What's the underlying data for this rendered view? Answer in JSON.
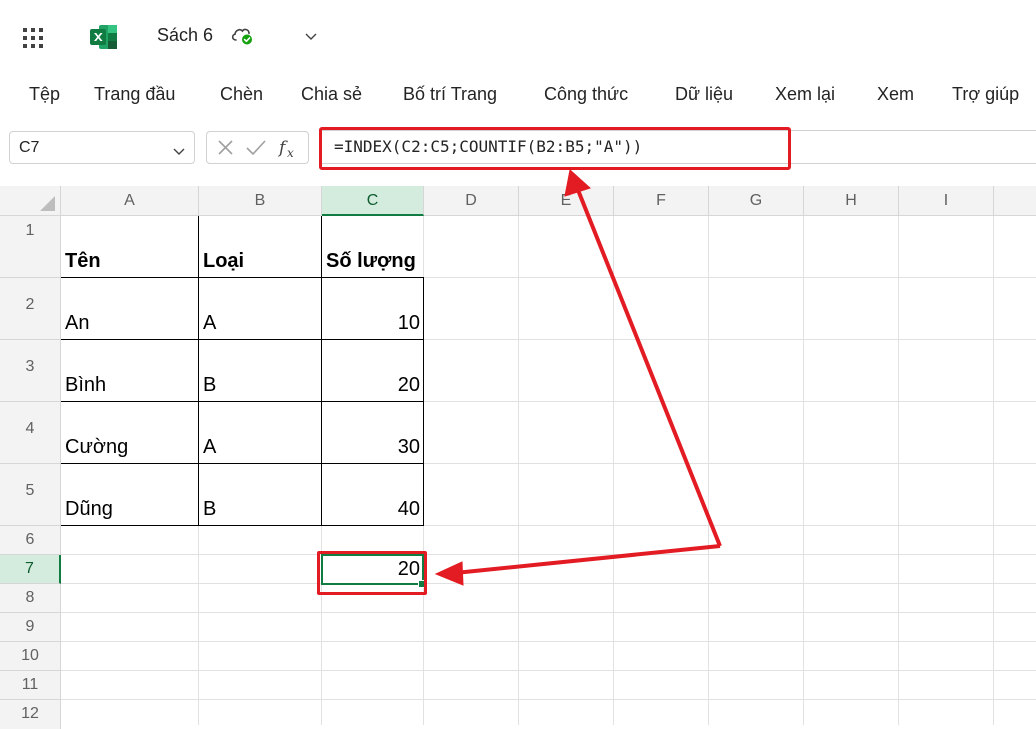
{
  "app": {
    "title": "Sách 6",
    "logo": "excel-logo",
    "brand_color": "#107c41"
  },
  "ribbon": {
    "tabs": [
      "Tệp",
      "Trang đầu",
      "Chèn",
      "Chia sẻ",
      "Bố trí Trang",
      "Công thức",
      "Dữ liệu",
      "Xem lại",
      "Xem",
      "Trợ giúp"
    ]
  },
  "formula_bar": {
    "name_box": "C7",
    "formula": "=INDEX(C2:C5;COUNTIF(B2:B5;\"A\"))"
  },
  "sheet": {
    "columns": [
      "A",
      "B",
      "C",
      "D",
      "E",
      "F",
      "G",
      "H",
      "I"
    ],
    "rows": [
      "1",
      "2",
      "3",
      "4",
      "5",
      "6",
      "7",
      "8",
      "9",
      "10",
      "11",
      "12"
    ],
    "selected_column": "C",
    "selected_row": "7",
    "table": {
      "headers": [
        "Tên",
        "Loại",
        "Số lượng"
      ],
      "rows": [
        [
          "An",
          "A",
          "10"
        ],
        [
          "Bình",
          "B",
          "20"
        ],
        [
          "Cường",
          "A",
          "30"
        ],
        [
          "Dũng",
          "B",
          "40"
        ]
      ]
    },
    "result_cell": {
      "ref": "C7",
      "value": "20"
    }
  },
  "annotations": {
    "highlight_color": "#e31b23"
  }
}
